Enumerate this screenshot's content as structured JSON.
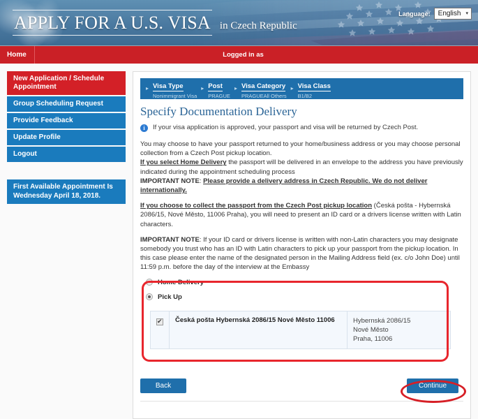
{
  "header": {
    "title": "APPLY FOR A U.S. VISA",
    "subtitle": "in  Czech Republic",
    "language_label": "Language:",
    "language_value": "English",
    "caret": "▾"
  },
  "nav": {
    "home": "Home",
    "logged_in": "Logged in as"
  },
  "sidebar": {
    "items": [
      {
        "label": "New Application / Schedule Appointment",
        "state": "active"
      },
      {
        "label": "Group Scheduling Request",
        "state": "normal"
      },
      {
        "label": "Provide Feedback",
        "state": "normal"
      },
      {
        "label": "Update Profile",
        "state": "normal"
      },
      {
        "label": "Logout",
        "state": "normal"
      }
    ],
    "note": "First Available Appointment Is Wednesday April 18, 2018."
  },
  "breadcrumbs": [
    {
      "title": "Visa Type",
      "sub": "Nonimmigrant Visa"
    },
    {
      "title": "Post",
      "sub": "PRAGUE"
    },
    {
      "title": "Visa Category",
      "sub": "PRAGUEAll Others"
    },
    {
      "title": "Visa Class",
      "sub": "B1/B2"
    }
  ],
  "main": {
    "page_title": "Specify Documentation Delivery",
    "info_icon_glyph": "i",
    "info_text": "If your visa application is approved, your passport and visa will be returned by Czech Post.",
    "paragraph_1_a": "You may choose to have your passport returned to your home/business address or you may choose personal collection from a Czech Post pickup location.",
    "paragraph_1_bold": "If you select Home Delivery",
    "paragraph_1_b": " the passport will be delivered in an envelope to the address you have previously indicated during the appointment scheduling process",
    "paragraph_1_note_label": "IMPORTANT NOTE",
    "paragraph_1_note_body": "Please provide a delivery address in Czech Republic. We do not deliver internationally.",
    "paragraph_2_bold": "If you choose to collect the passport from the Czech Post pickup location",
    "paragraph_2_rest": " (Česká pošta - Hybernská 2086/15, Nové Město, 11006 Praha), you will need to present an ID card or a drivers license written with Latin characters.",
    "paragraph_3_note_label": "IMPORTANT NOTE",
    "paragraph_3_body": ": If your ID card or drivers license is written with non-Latin characters you may designate somebody you trust who has an ID with Latin characters to pick up your passport from the pickup location. In this case please enter the name of the designated person in the Mailing Address field (ex. c/o John Doe) until 11:59 p.m. before the day of the interview at the Embassy",
    "delivery_options": [
      {
        "label": "Home Delivery",
        "selected": false
      },
      {
        "label": "Pick Up",
        "selected": true
      }
    ],
    "location_rows": [
      {
        "checked": true,
        "name": "Česká pošta Hybernská 2086/15 Nové Město 11006",
        "address_line1": "Hybernská 2086/15",
        "address_line2": "Nové Město",
        "address_line3": "Praha,  11006"
      }
    ],
    "back_button": "Back",
    "continue_button": "Continue"
  },
  "annotations": {
    "highlight_color": "#e8262d"
  }
}
